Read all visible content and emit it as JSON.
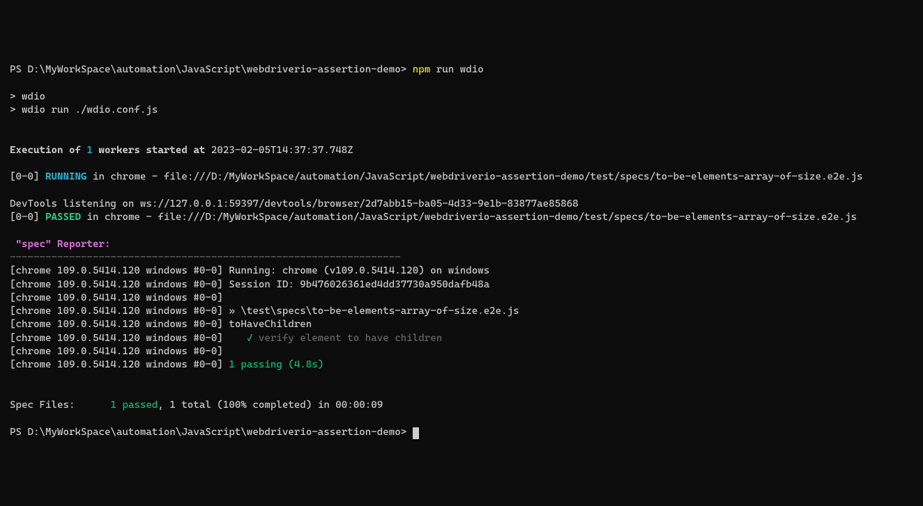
{
  "prompt1": {
    "prefix": "PS ",
    "path": "D:\\MyWorkSpace\\automation\\JavaScript\\webdriverio-assertion-demo",
    "suffix": "> ",
    "command": "npm",
    "args": " run wdio"
  },
  "echo": {
    "line1": "> wdio",
    "line2": "> wdio run ./wdio.conf.js"
  },
  "exec": {
    "prefix": "Execution of ",
    "workers": "1",
    "mid": " workers started at",
    "time": " 2023-02-05T14:37:37.748Z"
  },
  "running": {
    "id": "[0-0] ",
    "status": "RUNNING",
    "rest": " in chrome - file:///D:/MyWorkSpace/automation/JavaScript/webdriverio-assertion-demo/test/specs/to-be-elements-array-of-size.e2e.js"
  },
  "devtools": "DevTools listening on ws://127.0.0.1:59397/devtools/browser/2d7abb15-ba05-4d33-9e1b-83877ae85868",
  "passed": {
    "id": "[0-0] ",
    "status": "PASSED",
    "rest": " in chrome - file:///D:/MyWorkSpace/automation/JavaScript/webdriverio-assertion-demo/test/specs/to-be-elements-array-of-size.e2e.js"
  },
  "reporter": {
    "spec": " \"spec\"",
    "label": " Reporter:"
  },
  "divider": "------------------------------------------------------------------",
  "browser_prefix": "[chrome 109.0.5414.120 windows #0-0]",
  "rep": {
    "line1": " Running: chrome (v109.0.5414.120) on windows",
    "line2": " Session ID: 9b476026361ed4dd37730a950dafb48a",
    "line3": "",
    "line4": " » \\test\\specs\\to-be-elements-array-of-size.e2e.js",
    "line5": " toHaveChildren",
    "check_pad": "    ",
    "check": "✓",
    "check_text": " verify element to have children",
    "line7": "",
    "passing": " 1 passing (4.8s)"
  },
  "summary": {
    "label": "Spec Files:",
    "pad": "      ",
    "passed": "1 passed",
    "rest": ", 1 total (100% completed) in 00:00:09"
  },
  "prompt2": {
    "prefix": "PS ",
    "path": "D:\\MyWorkSpace\\automation\\JavaScript\\webdriverio-assertion-demo",
    "suffix": "> "
  }
}
